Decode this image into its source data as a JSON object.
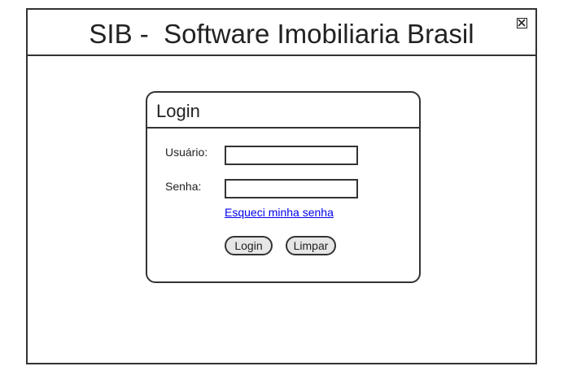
{
  "window": {
    "title": "SIB -  Software Imobiliaria Brasil",
    "close_icon": "close-box-icon"
  },
  "login": {
    "title": "Login",
    "username_label": "Usuário:",
    "username_value": "",
    "password_label": "Senha:",
    "password_value": "",
    "forgot_link": "Esqueci minha senha",
    "login_button": "Login",
    "clear_button": "Limpar"
  },
  "colors": {
    "border": "#333333",
    "link": "#0000ee",
    "button_bg": "#e6e6e6"
  }
}
